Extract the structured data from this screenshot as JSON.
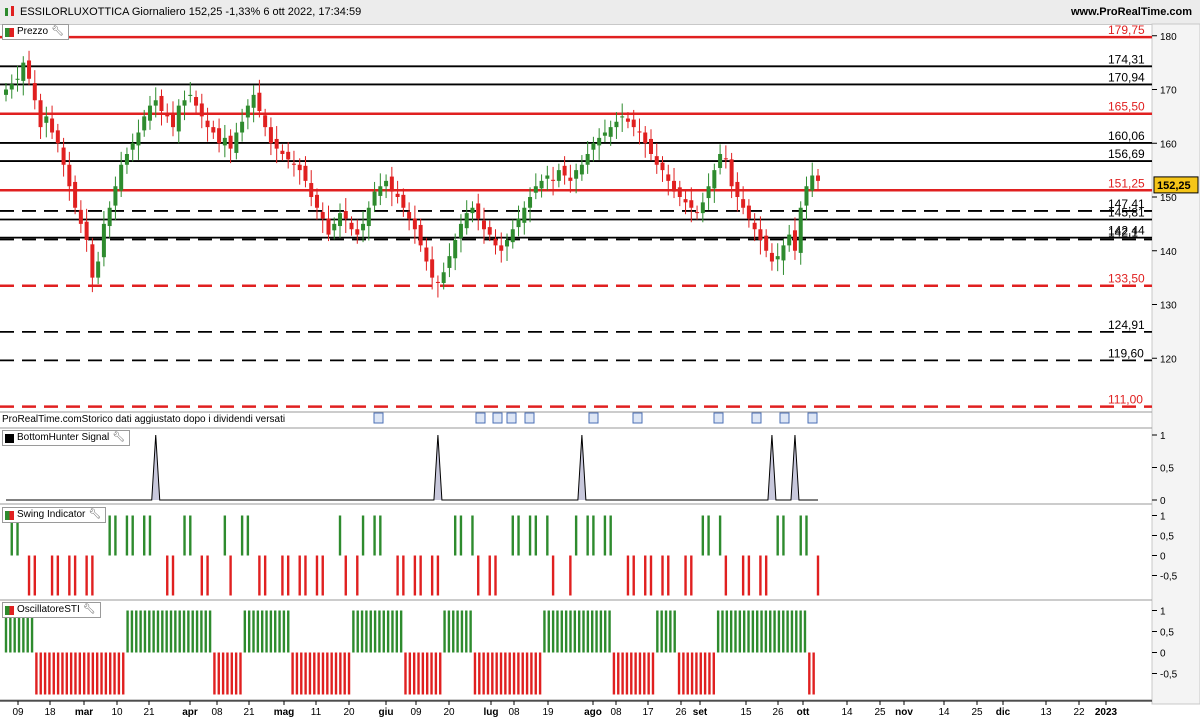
{
  "header": {
    "title": "ESSILORLUXOTTICA Giornaliero 152,25 -1,33% 6 ott 2022, 17:34:59",
    "brand": "www.ProRealTime.com"
  },
  "note": "ProRealTime.comStorico dati aggiustato dopo i dividendi versati",
  "colors": {
    "up": "#2e8b2e",
    "down": "#e02020",
    "level_red": "#e02020",
    "level_black": "#000000",
    "axis_bg": "#f4f4f4"
  },
  "x_axis": {
    "labels": [
      "09",
      "18",
      "mar",
      "10",
      "21",
      "apr",
      "08",
      "21",
      "mag",
      "11",
      "20",
      "giu",
      "09",
      "20",
      "lug",
      "08",
      "19",
      "ago",
      "08",
      "17",
      "26",
      "set",
      "15",
      "26",
      "ott",
      "14",
      "25",
      "nov",
      "14",
      "25",
      "dic",
      "13",
      "22",
      "2023"
    ]
  },
  "chart_data": [
    {
      "name": "Prezzo",
      "type": "candlestick",
      "title": "Prezzo",
      "last_price": "152,25",
      "ylim": [
        110,
        182
      ],
      "y_ticks": [
        "180",
        "170",
        "160",
        "150",
        "140",
        "130",
        "120"
      ],
      "levels": [
        {
          "value": 179.75,
          "label": "179,75",
          "color": "red",
          "style": "solid"
        },
        {
          "value": 174.31,
          "label": "174,31",
          "color": "black",
          "style": "solid"
        },
        {
          "value": 170.94,
          "label": "170,94",
          "color": "black",
          "style": "solid"
        },
        {
          "value": 165.5,
          "label": "165,50",
          "color": "red",
          "style": "solid"
        },
        {
          "value": 160.06,
          "label": "160,06",
          "color": "black",
          "style": "solid"
        },
        {
          "value": 156.69,
          "label": "156,69",
          "color": "black",
          "style": "solid"
        },
        {
          "value": 151.25,
          "label": "151,25",
          "color": "red",
          "style": "solid"
        },
        {
          "value": 147.41,
          "label": "147,41",
          "color": "black",
          "style": "dashed"
        },
        {
          "value": 145.81,
          "label": "145,81",
          "color": "black",
          "style": "solid"
        },
        {
          "value": 142.44,
          "label": "142,44",
          "color": "black",
          "style": "solid"
        },
        {
          "value": 142.1,
          "label": "142,1",
          "color": "black",
          "style": "dashed"
        },
        {
          "value": 133.5,
          "label": "133,50",
          "color": "red",
          "style": "dashed"
        },
        {
          "value": 124.91,
          "label": "124,91",
          "color": "black",
          "style": "dashed"
        },
        {
          "value": 119.6,
          "label": "119,60",
          "color": "black",
          "style": "dashed"
        },
        {
          "value": 111.0,
          "label": "111,00",
          "color": "red",
          "style": "dashed"
        }
      ],
      "close": [
        170,
        171,
        172,
        175,
        172,
        168,
        163,
        165,
        162,
        160,
        156,
        152,
        148,
        145,
        142,
        135,
        138,
        145,
        148,
        152,
        156,
        158,
        160,
        162,
        165,
        167,
        168,
        166,
        165,
        163,
        167,
        168,
        169,
        167,
        165,
        163,
        162,
        160,
        161,
        159,
        162,
        164,
        167,
        169,
        166,
        163,
        160,
        159,
        158,
        157,
        156,
        155,
        153,
        150,
        148,
        146,
        143,
        145,
        147,
        146,
        144,
        143,
        145,
        148,
        151,
        152,
        153,
        151,
        150,
        148,
        146,
        144,
        141,
        138,
        135,
        134,
        136,
        139,
        142,
        145,
        147,
        148,
        146,
        144,
        143,
        141,
        140,
        142,
        144,
        146,
        148,
        150,
        152,
        153,
        154,
        153,
        155,
        154,
        153,
        155,
        156,
        158,
        160,
        161,
        162,
        163,
        164,
        165,
        164,
        163,
        162,
        160,
        158,
        156,
        155,
        153,
        151,
        150,
        149,
        148,
        147,
        149,
        152,
        155,
        158,
        157,
        152,
        150,
        148,
        146,
        144,
        142,
        140,
        138,
        139,
        141,
        143,
        140,
        148,
        152,
        154,
        153
      ],
      "oscillator_markers_ids": 10
    },
    {
      "name": "BottomHunter Signal",
      "type": "area",
      "title": "BottomHunter Signal",
      "ylim": [
        0,
        1
      ],
      "y_ticks": [
        "1",
        "0,5",
        "0"
      ],
      "peaks_at_bar": [
        26,
        75,
        100,
        133,
        137
      ]
    },
    {
      "name": "Swing Indicator",
      "type": "bar",
      "title": "Swing Indicator",
      "ylim": [
        -1,
        1
      ],
      "y_ticks": [
        "1",
        "0,5",
        "0",
        "-0,5"
      ],
      "pattern": "alternating up/down swings over the same bars as the price series"
    },
    {
      "name": "OscillatoreSTI",
      "type": "bar",
      "title": "OscillatoreSTI",
      "ylim": [
        -1,
        1
      ],
      "y_ticks": [
        "1",
        "0,5",
        "0",
        "-0,5"
      ],
      "runs": [
        [
          0,
          7,
          1
        ],
        [
          7,
          28,
          -1
        ],
        [
          28,
          48,
          1
        ],
        [
          48,
          55,
          -1
        ],
        [
          55,
          66,
          1
        ],
        [
          66,
          80,
          -1
        ],
        [
          80,
          92,
          1
        ],
        [
          92,
          101,
          -1
        ],
        [
          101,
          108,
          1
        ],
        [
          108,
          124,
          -1
        ],
        [
          124,
          140,
          1
        ],
        [
          140,
          150,
          -1
        ],
        [
          150,
          155,
          1
        ],
        [
          155,
          164,
          -1
        ],
        [
          164,
          185,
          1
        ],
        [
          185,
          187,
          -1
        ]
      ]
    }
  ]
}
